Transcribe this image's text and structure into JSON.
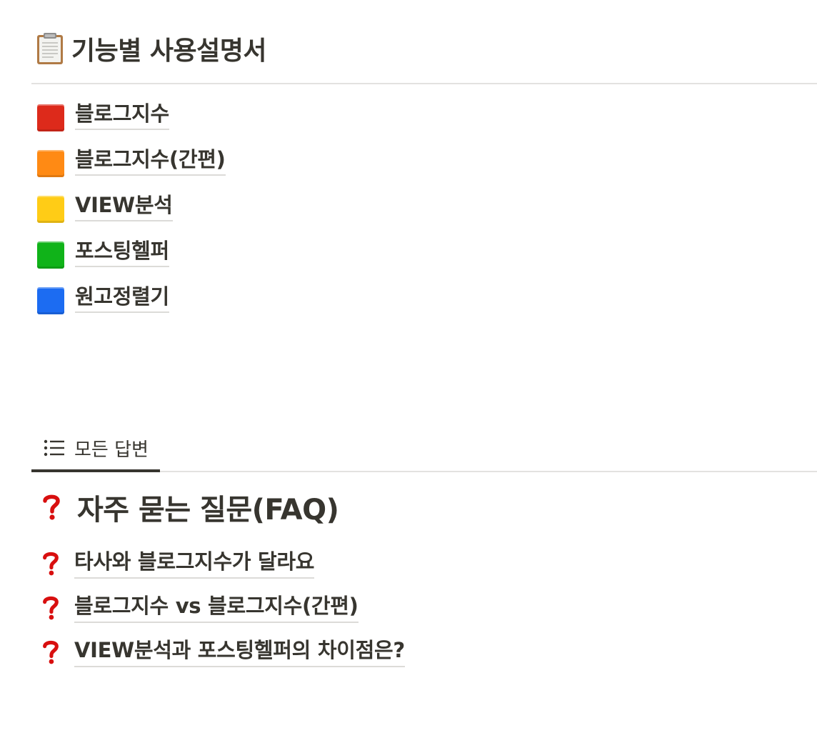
{
  "manual_section": {
    "icon": "clipboard-icon",
    "title": "기능별 사용설명서",
    "pages": [
      {
        "label": "블로그지수",
        "icon": "red-square-icon",
        "color": "#dd2a1b"
      },
      {
        "label": "블로그지수(간편)",
        "icon": "orange-square-icon",
        "color": "#ff8a14"
      },
      {
        "label": "VIEW분석",
        "icon": "yellow-square-icon",
        "color": "#ffcc16"
      },
      {
        "label": "포스팅헬퍼",
        "icon": "green-square-icon",
        "color": "#10b319"
      },
      {
        "label": "원고정렬기",
        "icon": "blue-square-icon",
        "color": "#1c6cf2"
      }
    ]
  },
  "tabs": [
    {
      "label": "모든 답변",
      "icon": "list-icon",
      "active": true
    }
  ],
  "faq": {
    "heading_icon": "question-mark-icon",
    "heading": "자주 묻는 질문(FAQ)",
    "items": [
      {
        "label": "타사와 블로그지수가 달라요",
        "icon": "question-mark-icon"
      },
      {
        "label": "블로그지수 vs 블로그지수(간편)",
        "icon": "question-mark-icon"
      },
      {
        "label": "VIEW분석과 포스팅헬퍼의 차이점은?",
        "icon": "question-mark-icon"
      }
    ]
  },
  "colors": {
    "text": "#37352f",
    "question_mark": "#d80f0f",
    "divider": "#e3e2e0"
  }
}
